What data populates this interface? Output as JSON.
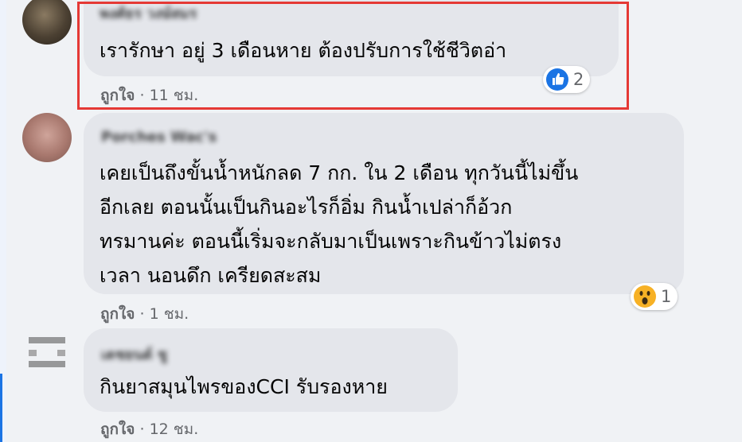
{
  "comments": [
    {
      "author": "พงศ์ธร วงษ์สมร",
      "text": "เรารักษา อยู่ 3 เดือนหาย ต้องปรับการใช้ชีวิตอ่า",
      "like_label": "ถูกใจ",
      "separator": "·",
      "time": "11 ชม.",
      "reaction_icon": "thumbs-up-icon",
      "reaction_count": "2"
    },
    {
      "author": "Porches Wac's",
      "text": "เคยเป็นถึงขั้นน้ำหนักลด 7 กก. ใน 2 เดือน ทุกวันนี้ไม่ขึ้น\nอีกเลย ตอนนั้นเป็นกินอะไรก็อิ่ม กินน้ำเปล่าก็อ้วก\nทรมานค่ะ ตอนนี้เริ่มจะกลับมาเป็นเพราะกินข้าวไม่ตรง\nเวลา นอนดึก เครียดสะสม",
      "like_label": "ถูกใจ",
      "separator": "·",
      "time": "1 ชม.",
      "reaction_icon": "wow-icon",
      "reaction_count": "1"
    },
    {
      "author": "เตชยนต์ ชู",
      "text": "กินยาสมุนไพรของCCI รับรองหาย",
      "like_label": "ถูกใจ",
      "separator": "·",
      "time": "12 ชม."
    }
  ],
  "colors": {
    "highlight": "#e53935",
    "like_blue": "#1b74e4",
    "wow_yellow": "#f7b125",
    "bubble": "#e4e6eb",
    "background": "#f0f2f5"
  }
}
